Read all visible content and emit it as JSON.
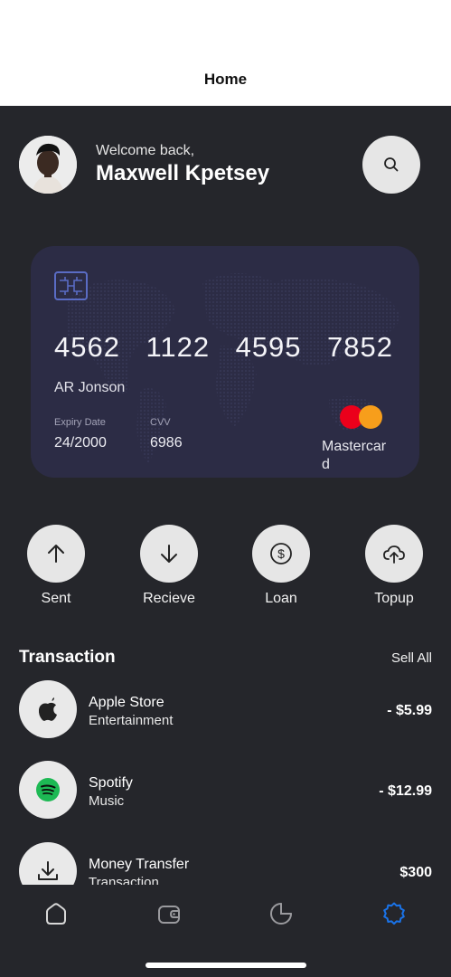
{
  "topbar": {
    "title": "Home"
  },
  "header": {
    "welcome": "Welcome back,",
    "name": "Maxwell Kpetsey",
    "search_icon": "search-icon"
  },
  "card": {
    "number_groups": [
      "4562",
      "1122",
      "4595",
      "7852"
    ],
    "holder": "AR Jonson",
    "expiry_label": "Expiry Date",
    "expiry_value": "24/2000",
    "cvv_label": "CVV",
    "cvv_value": "6986",
    "network": "Mastercard",
    "colors": {
      "background": "#2c2c45",
      "chip": "#5a6cc4",
      "mc_red": "#eb001b",
      "mc_orange": "#f79e1b"
    }
  },
  "actions": [
    {
      "label": "Sent",
      "icon": "arrow-up-icon"
    },
    {
      "label": "Recieve",
      "icon": "arrow-down-icon"
    },
    {
      "label": "Loan",
      "icon": "dollar-circle-icon"
    },
    {
      "label": "Topup",
      "icon": "cloud-upload-icon"
    }
  ],
  "transactions": {
    "title": "Transaction",
    "see_all": "Sell All",
    "items": [
      {
        "name": "Apple Store",
        "category": "Entertainment",
        "amount": "- $5.99",
        "icon": "apple-icon"
      },
      {
        "name": "Spotify",
        "category": "Music",
        "amount": "- $12.99",
        "icon": "spotify-icon"
      },
      {
        "name": "Money Transfer",
        "category": "Transaction",
        "amount": "$300",
        "icon": "download-icon"
      }
    ]
  },
  "navbar": {
    "items": [
      {
        "name": "home",
        "icon": "home-icon",
        "active": false
      },
      {
        "name": "wallet",
        "icon": "wallet-icon",
        "active": false
      },
      {
        "name": "stats",
        "icon": "pie-chart-icon",
        "active": false
      },
      {
        "name": "settings",
        "icon": "settings-icon",
        "active": true
      }
    ],
    "active_color": "#1a73e8"
  }
}
